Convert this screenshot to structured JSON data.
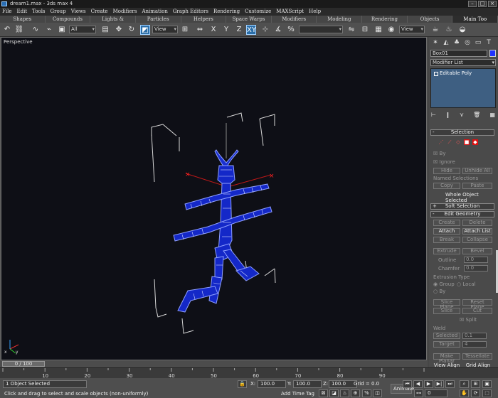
{
  "window": {
    "title": "dream1.max - 3ds max 4"
  },
  "menu": [
    "File",
    "Edit",
    "Tools",
    "Group",
    "Views",
    "Create",
    "Modifiers",
    "Animation",
    "Graph Editors",
    "Rendering",
    "Customize",
    "MAXScript",
    "Help"
  ],
  "tabs": [
    "Shapes",
    "Compounds",
    "Lights & Cameras",
    "Particles",
    "Helpers",
    "Space Warps",
    "Modifiers",
    "Modeling",
    "Rendering",
    "Objects",
    "Main Too"
  ],
  "toolbar": {
    "selection_filter": "All",
    "ref_coord": "View",
    "view_dropdown": "View",
    "named_sel": ""
  },
  "viewport": {
    "label": "Perspective"
  },
  "command_panel": {
    "object_name": "Box01",
    "object_color": "#2030ff",
    "modifier_list": "Modifier List",
    "stack_item": "Editable Poly",
    "rollouts": {
      "selection": "Selection",
      "soft_selection": "Soft Selection",
      "edit_geometry": "Edit Geometry"
    },
    "selection": {
      "by_label": "By",
      "ignore_label": "Ignore",
      "hide_label": "Hide",
      "unhide_all_label": "Unhide All",
      "named_selections_label": "Named Selections",
      "copy_label": "Copy",
      "paste_label": "Paste",
      "status": "Whole Object Selected"
    },
    "edit_geometry": {
      "create_label": "Create",
      "delete_label": "Delete",
      "attach_label": "Attach",
      "attach_list_label": "Attach List",
      "break_label": "Break",
      "collapse_label": "Collapse",
      "extrude_label": "Extrude",
      "bevel_label": "Bevel",
      "outline_label": "Outline",
      "chamfer_label": "Chamfer",
      "extrusion_type_label": "Extrusion Type",
      "group_label": "Group",
      "local_label": "Local",
      "by_label": "By",
      "slice_plane_label": "Slice Plane",
      "reset_plane_label": "Reset Plane",
      "slice_label": "Slice",
      "cut_label": "Cut",
      "split_label": "Split",
      "weld_label": "Weld",
      "selected_label": "Selected",
      "target_label": "Target",
      "make_planar_label": "Make Planar",
      "view_align_label": "View Align",
      "grid_align_label": "Grid Align"
    }
  },
  "time": {
    "slider_label": "0 / 100",
    "ticks": [
      "10",
      "20",
      "30",
      "40",
      "50",
      "60",
      "70",
      "80",
      "90"
    ]
  },
  "status": {
    "selected": "1 Object Selected",
    "prompt": "Click and drag to select and scale objects (non-uniformly)",
    "x_label": "X:",
    "x_value": "100.0",
    "y_label": "Y:",
    "y_value": "100.0",
    "z_label": "Z:",
    "z_value": "100.0",
    "grid": "Grid = 0.0",
    "add_time_tag": "Add Time Tag",
    "animate_label": "Animate",
    "frame": "0"
  }
}
